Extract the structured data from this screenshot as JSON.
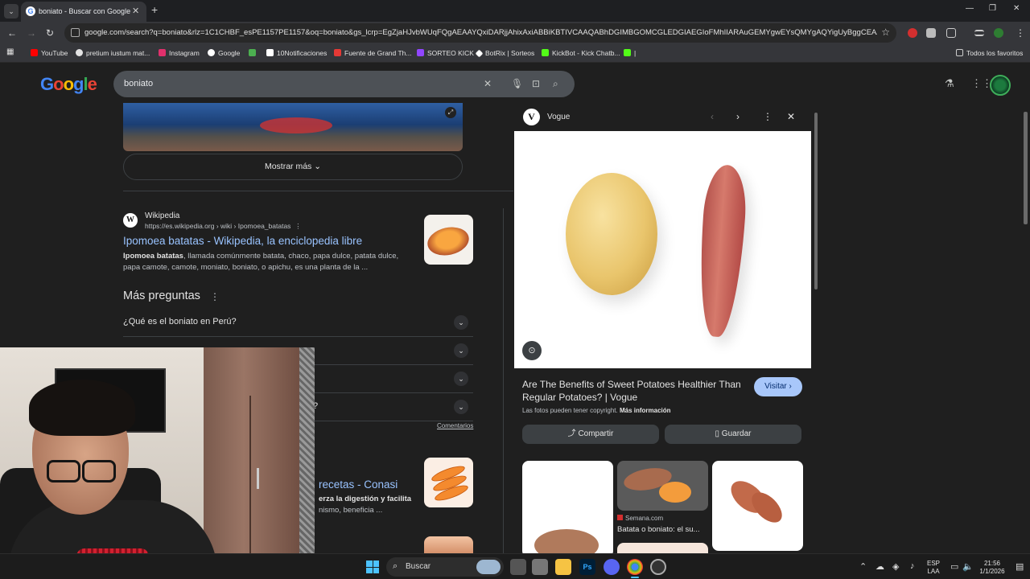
{
  "browser": {
    "tab_title": "boniato - Buscar con Google",
    "url": "google.com/search?q=boniato&rlz=1C1CHBF_esPE1157PE1157&oq=boniato&gs_lcrp=EgZjaHJvbWUqFQgAEAAYQxiDARjjAhixAxiABBiKBTIVCAAQABhDGIMBGOMCGLEDGIAEGIoFMhIIARAuGEMYgwEYsQMYgAQYigUyBggCEAAYAQyBwg...",
    "bookmarks": [
      {
        "label": "YouTube",
        "color": "#ff0000"
      },
      {
        "label": "pretium iustum mat...",
        "color": "#e3e3e3"
      },
      {
        "label": "Instagram",
        "color": "#e1306c"
      },
      {
        "label": "Google",
        "color": "#ffffff"
      },
      {
        "label": "",
        "color": "#4caf50"
      },
      {
        "label": "10Notificaciones",
        "color": "#ffffff"
      },
      {
        "label": "Fuente de Grand Th...",
        "color": "#e53935"
      },
      {
        "label": "SORTEO KICK",
        "color": "#9146ff"
      },
      {
        "label": "BotRix | Sorteos",
        "color": "#ffffff"
      },
      {
        "label": "KickBot - Kick Chatb...",
        "color": "#53fc18"
      },
      {
        "label": "|",
        "color": "#53fc18"
      }
    ],
    "all_bookmarks": "Todos los favoritos"
  },
  "google": {
    "logo": [
      "G",
      "o",
      "o",
      "g",
      "l",
      "e"
    ],
    "query": "boniato",
    "show_more": "Mostrar más",
    "result1": {
      "source": "Wikipedia",
      "source_initial": "W",
      "url": "https://es.wikipedia.org › wiki › Ipomoea_batatas",
      "title": "Ipomoea batatas - Wikipedia, la enciclopedia libre",
      "snippet_bold": "Ipomoea batatas",
      "snippet": ", llamada comúnmente batata, chaco, papa dulce, patata dulce, papa camote, camote, moniato, boniato, o apichu, es una planta de la ..."
    },
    "more_questions": {
      "title": "Más preguntas",
      "items": [
        "¿Qué es el boniato en Perú?",
        "",
        "",
        "?"
      ]
    },
    "feedback": "Comentarios",
    "result2": {
      "title": "recetas - Conasi",
      "snippet_line1_bold": "erza la digestión y facilita",
      "snippet_line2": "nismo, beneficia ..."
    }
  },
  "side_panel": {
    "source": "Vogue",
    "source_initial": "V",
    "title": "Are The Benefits of Sweet Potatoes Healthier Than Regular Potatoes? | Vogue",
    "visit": "Visitar",
    "copyright": "Las fotos pueden tener copyright.",
    "more_info": "Más información",
    "share": "Compartir",
    "save": "Guardar",
    "related_source": "Semana.com",
    "related_caption": "Batata o boniato: el su..."
  },
  "taskbar": {
    "search": "Buscar",
    "lang": "ESP",
    "lang2": "LAA",
    "time": "21:56",
    "date": "1/1/2026"
  }
}
